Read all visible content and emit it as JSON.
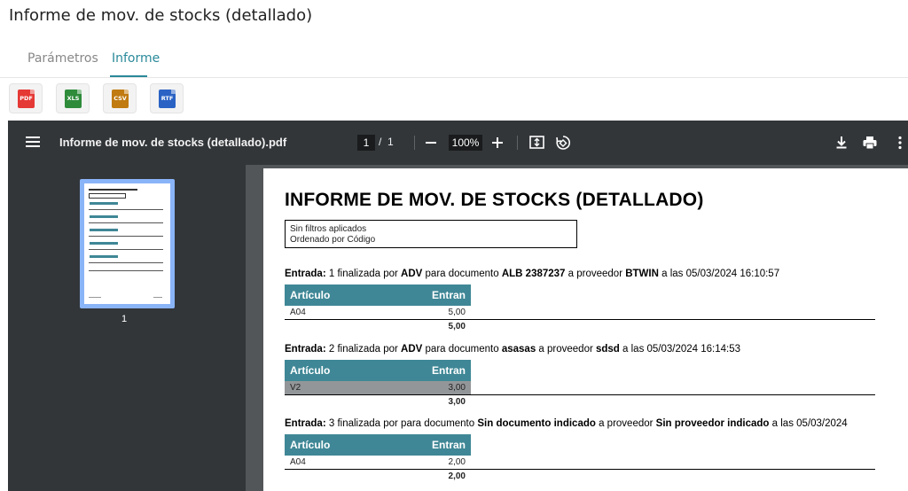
{
  "page": {
    "title": "Informe de mov. de stocks (detallado)"
  },
  "tabs": [
    {
      "label": "Parámetros"
    },
    {
      "label": "Informe"
    }
  ],
  "exports": [
    {
      "label": "PDF",
      "color": "#e53935"
    },
    {
      "label": "XLS",
      "color": "#2e8b3a"
    },
    {
      "label": "CSV",
      "color": "#c07a10"
    },
    {
      "label": "RTF",
      "color": "#2a63c4"
    }
  ],
  "viewer": {
    "file_name": "Informe de mov. de stocks (detallado).pdf",
    "page_current": "1",
    "page_separator": "/",
    "page_total": "1",
    "zoom": "100%",
    "thumbnail_label": "1"
  },
  "report": {
    "title": "INFORME DE MOV. DE STOCKS (DETALLADO)",
    "filters_line1": "Sin filtros aplicados",
    "filters_line2": "Ordenado por Código",
    "col_article": "Artículo",
    "col_in": "Entran",
    "entries": [
      {
        "label": "Entrada:",
        "text1": " 1 finalizada por ",
        "user": "ADV",
        "text2": " para documento ",
        "document": "ALB 2387237",
        "text3": " a proveedor ",
        "supplier": "BTWIN",
        "text4": " a las 05/03/2024 16:10:57",
        "rows": [
          {
            "article": "A04",
            "qty": "5,00"
          }
        ],
        "total": "5,00"
      },
      {
        "label": "Entrada:",
        "text1": " 2 finalizada por ",
        "user": "ADV",
        "text2": " para documento ",
        "document": "asasas",
        "text3": " a proveedor ",
        "supplier": "sdsd",
        "text4": " a las 05/03/2024 16:14:53",
        "rows": [
          {
            "article": "V2",
            "qty": "3,00"
          }
        ],
        "total": "3,00"
      },
      {
        "label": "Entrada:",
        "text1": " 3 finalizada por para documento ",
        "user": "",
        "text2": "",
        "document": "Sin documento indicado",
        "text3": " a proveedor ",
        "supplier": "Sin proveedor indicado",
        "text4": " a las 05/03/2024",
        "rows": [
          {
            "article": "A04",
            "qty": "2,00"
          }
        ],
        "total": "2,00"
      }
    ]
  }
}
